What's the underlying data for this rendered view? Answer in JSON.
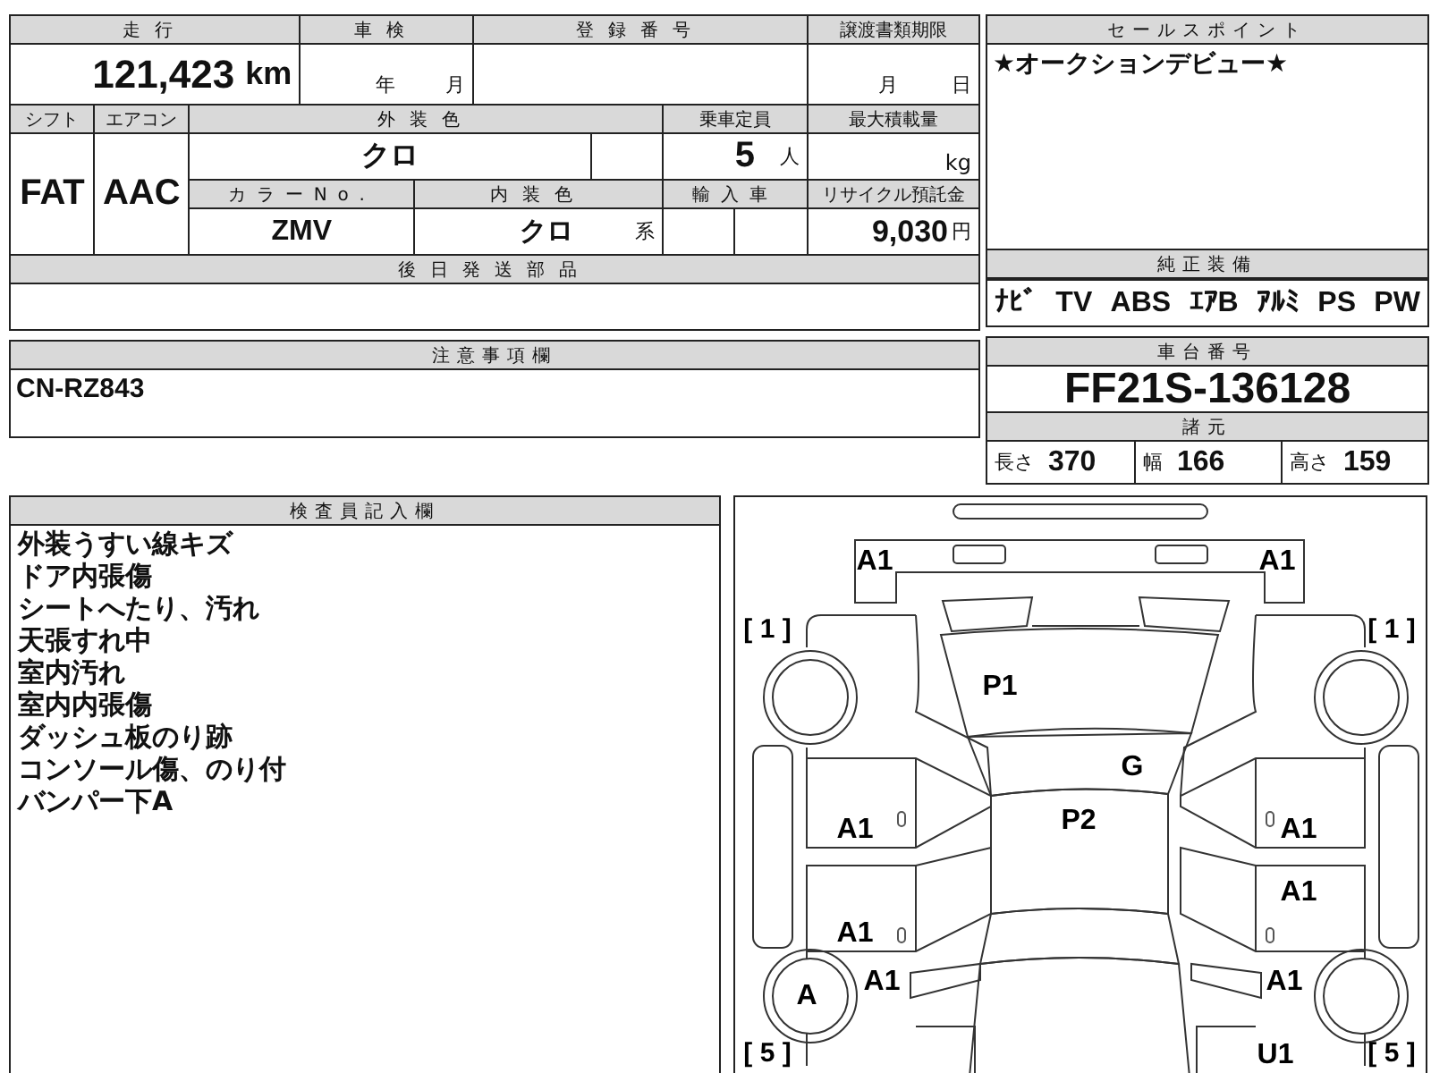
{
  "vehicle_info": {
    "mileage": {
      "label": "走行",
      "value": "121,423",
      "unit": "km"
    },
    "inspection": {
      "label": "車検",
      "year_unit": "年",
      "month_unit": "月"
    },
    "registration_number": {
      "label": "登録番号"
    },
    "document_deadline": {
      "label": "譲渡書類期限",
      "month_unit": "月",
      "day_unit": "日"
    },
    "shift": {
      "label": "シフト",
      "value": "FAT"
    },
    "air_conditioner": {
      "label": "エアコン",
      "value": "AAC"
    },
    "exterior_color": {
      "label": "外装色",
      "value": "クロ"
    },
    "capacity": {
      "label": "乗車定員",
      "value": "5",
      "unit": "人"
    },
    "max_load": {
      "label": "最大積載量",
      "unit": "kg"
    },
    "color_number": {
      "label": "カラーNo.",
      "value": "ZMV"
    },
    "interior_color": {
      "label": "内装色",
      "value": "クロ",
      "suffix": "系"
    },
    "imported": {
      "label": "輸入車"
    },
    "recycling_fee": {
      "label": "リサイクル預託金",
      "value": "9,030",
      "unit": "円"
    },
    "parts_to_follow": {
      "label": "後日発送部品"
    }
  },
  "sales_point": {
    "title": "セールスポイント",
    "text": "★オークションデビュー★"
  },
  "equipment": {
    "title": "純正装備",
    "items": [
      "ﾅﾋﾞ",
      "TV",
      "ABS",
      "ｴｱB",
      "ｱﾙﾐ",
      "PS",
      "PW"
    ]
  },
  "notes": {
    "title": "注意事項欄",
    "text": "CN-RZ843"
  },
  "chassis": {
    "title": "車台番号",
    "number": "FF21S-136128",
    "specs_title": "諸元",
    "specs": [
      {
        "label": "長さ",
        "value": "370"
      },
      {
        "label": "幅",
        "value": "166"
      },
      {
        "label": "高さ",
        "value": "159"
      }
    ]
  },
  "inspector": {
    "title": "検査員記入欄",
    "lines": [
      "外装うすい線キズ",
      "ドア内張傷",
      "シートへたり、汚れ",
      "天張すれ中",
      "室内汚れ",
      "室内内張傷",
      "ダッシュ板のり跡",
      "コンソール傷、のり付",
      "バンパー下A"
    ]
  },
  "diagram": {
    "damage_marks": [
      "A1",
      "A1",
      "P1",
      "G",
      "P2",
      "A1",
      "A1",
      "A1",
      "A1",
      "A1",
      "A",
      "A1",
      "U1"
    ],
    "tire_ratings": [
      "[ 1 ]",
      "[ 1 ]",
      "[ 5 ]",
      "[ 5 ]"
    ]
  }
}
